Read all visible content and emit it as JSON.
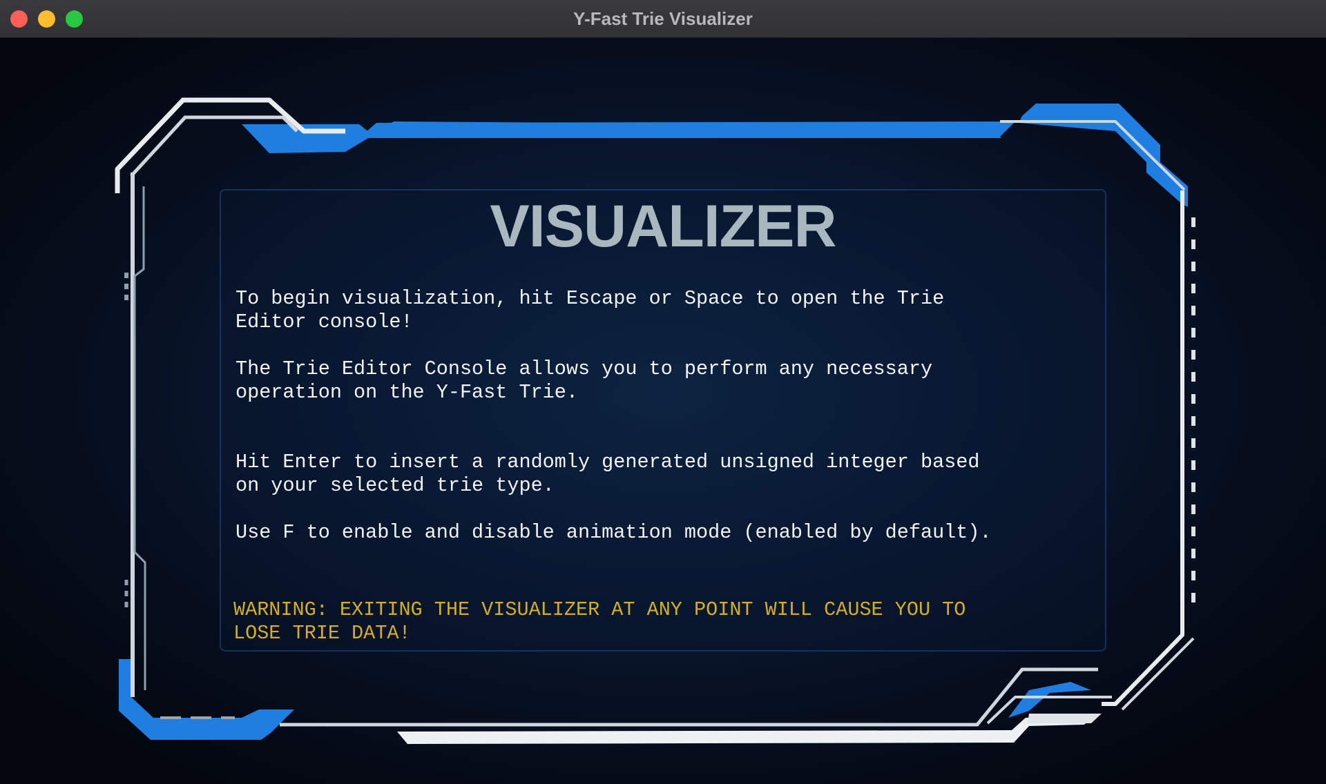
{
  "window": {
    "title": "Y-Fast Trie Visualizer"
  },
  "colors": {
    "accent_blue": "#1f7fe0",
    "frame_white": "#e8ecef",
    "warning": "#d6ae22",
    "heading": "#a9b8bf"
  },
  "main": {
    "heading": "VISUALIZER",
    "instructions": [
      "To begin visualization, hit Escape or Space to open the Trie\nEditor console!",
      "The Trie Editor Console allows you to perform any necessary\noperation on the Y-Fast Trie.",
      "Hit Enter to insert a randomly generated unsigned integer based\non your selected trie type.",
      "Use F to enable and disable animation mode (enabled by default)."
    ],
    "warning": "WARNING: EXITING THE VISUALIZER AT ANY POINT WILL CAUSE YOU TO\nLOSE TRIE DATA!"
  }
}
